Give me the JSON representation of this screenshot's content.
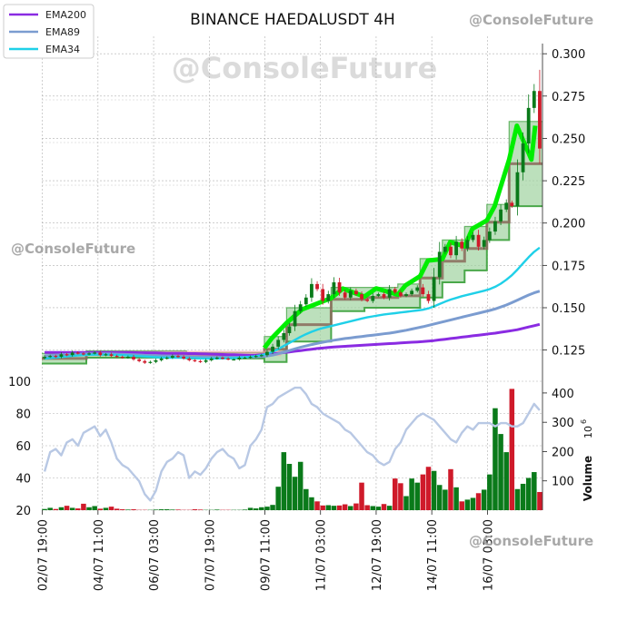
{
  "chart_data": {
    "type": "candlestick",
    "title": "BINANCE HAEDALUSDT 4H",
    "watermark": "@ConsoleFuture",
    "price_axis": {
      "range": [
        0.113,
        0.306
      ],
      "ticks": [
        0.125,
        0.15,
        0.175,
        0.2,
        0.225,
        0.25,
        0.275,
        0.3
      ],
      "tick_labels": [
        "0.125",
        "0.150",
        "0.175",
        "0.200",
        "0.225",
        "0.250",
        "0.275",
        "0.300"
      ]
    },
    "oscillator_axis": {
      "range": [
        20,
        100
      ],
      "ticks": [
        20,
        40,
        60,
        80,
        100
      ],
      "tick_labels": [
        "20",
        "40",
        "60",
        "80",
        "100"
      ]
    },
    "volume_axis": {
      "label": "Volume",
      "unit_label": "10",
      "unit_exponent": "6",
      "range": [
        0,
        440
      ],
      "ticks": [
        100,
        200,
        300,
        400
      ],
      "tick_labels": [
        "100",
        "200",
        "300",
        "400"
      ]
    },
    "x_axis": {
      "candles": 90,
      "tick_indices": [
        0,
        10,
        20,
        30,
        40,
        50,
        60,
        70,
        80
      ],
      "tick_labels": [
        "02/07 19:00",
        "04/07 11:00",
        "06/07 03:00",
        "07/07 19:00",
        "09/07 11:00",
        "11/07 03:00",
        "12/07 19:00",
        "14/07 11:00",
        "16/07 03:00"
      ]
    },
    "legend": {
      "placement": "top-left",
      "entries": [
        {
          "name": "EMA200",
          "color": "#8a2be2"
        },
        {
          "name": "EMA89",
          "color": "#7b9cd0"
        },
        {
          "name": "EMA34",
          "color": "#1fd0e8"
        }
      ]
    },
    "colors": {
      "up": "#0a7a1a",
      "down": "#cf1a2a",
      "band_fill": "#9fd39f",
      "band_edge": "#4aa84a",
      "band_core": "#00ee00",
      "band_mid": "#8a6a5a",
      "early_band": "#ff9aa6",
      "oscillator": "#b8c8e4"
    },
    "close": [
      0.121,
      0.1215,
      0.121,
      0.1225,
      0.122,
      0.1235,
      0.123,
      0.1225,
      0.123,
      0.1235,
      0.122,
      0.1225,
      0.1215,
      0.121,
      0.1205,
      0.121,
      0.1195,
      0.1185,
      0.1175,
      0.118,
      0.119,
      0.12,
      0.1205,
      0.1215,
      0.121,
      0.12,
      0.119,
      0.1185,
      0.118,
      0.119,
      0.12,
      0.1205,
      0.12,
      0.1195,
      0.1195,
      0.1205,
      0.1205,
      0.121,
      0.1215,
      0.122,
      0.124,
      0.127,
      0.131,
      0.135,
      0.139,
      0.148,
      0.152,
      0.156,
      0.164,
      0.161,
      0.154,
      0.158,
      0.165,
      0.159,
      0.156,
      0.16,
      0.158,
      0.155,
      0.154,
      0.157,
      0.158,
      0.156,
      0.161,
      0.159,
      0.157,
      0.158,
      0.16,
      0.162,
      0.158,
      0.154,
      0.168,
      0.183,
      0.186,
      0.181,
      0.189,
      0.185,
      0.19,
      0.193,
      0.186,
      0.19,
      0.195,
      0.201,
      0.208,
      0.212,
      0.21,
      0.23,
      0.247,
      0.268,
      0.278,
      0.244
    ],
    "ema200": [
      0.1236,
      0.1236,
      0.1236,
      0.1236,
      0.1236,
      0.1236,
      0.1236,
      0.1236,
      0.1236,
      0.1236,
      0.1236,
      0.1236,
      0.1236,
      0.1236,
      0.1236,
      0.1236,
      0.1235,
      0.1234,
      0.1234,
      0.1233,
      0.1233,
      0.1232,
      0.1231,
      0.1231,
      0.123,
      0.123,
      0.1229,
      0.1229,
      0.1228,
      0.1227,
      0.1226,
      0.1225,
      0.1224,
      0.1223,
      0.1222,
      0.1221,
      0.122,
      0.1219,
      0.122,
      0.1222,
      0.1225,
      0.1228,
      0.1231,
      0.1235,
      0.1239,
      0.1243,
      0.1247,
      0.1251,
      0.1255,
      0.1259,
      0.1262,
      0.1265,
      0.1268,
      0.127,
      0.1272,
      0.1274,
      0.1276,
      0.1278,
      0.128,
      0.1282,
      0.1284,
      0.1286,
      0.1288,
      0.129,
      0.1292,
      0.1294,
      0.1296,
      0.1298,
      0.13,
      0.1303,
      0.1306,
      0.131,
      0.1314,
      0.1318,
      0.1322,
      0.1326,
      0.133,
      0.1334,
      0.1338,
      0.1342,
      0.1346,
      0.135,
      0.1355,
      0.136,
      0.1365,
      0.137,
      0.1378,
      0.1386,
      0.1394,
      0.1402
    ],
    "ema89": [
      0.1216,
      0.1218,
      0.122,
      0.1222,
      0.1224,
      0.1225,
      0.1226,
      0.1227,
      0.1228,
      0.1228,
      0.1228,
      0.1228,
      0.1227,
      0.1226,
      0.1225,
      0.1224,
      0.1223,
      0.1221,
      0.1219,
      0.1218,
      0.1217,
      0.1216,
      0.1215,
      0.1214,
      0.1213,
      0.1212,
      0.1211,
      0.121,
      0.1209,
      0.1208,
      0.1208,
      0.1207,
      0.1207,
      0.1207,
      0.1207,
      0.1207,
      0.1208,
      0.1209,
      0.121,
      0.1212,
      0.1215,
      0.122,
      0.1228,
      0.1237,
      0.1247,
      0.1257,
      0.1266,
      0.1274,
      0.1282,
      0.1289,
      0.1296,
      0.1302,
      0.1308,
      0.1313,
      0.1318,
      0.1322,
      0.1326,
      0.133,
      0.1334,
      0.1338,
      0.1342,
      0.1346,
      0.135,
      0.1355,
      0.1361,
      0.1367,
      0.1374,
      0.1381,
      0.1388,
      0.1396,
      0.1404,
      0.1412,
      0.142,
      0.1428,
      0.1436,
      0.1444,
      0.1452,
      0.146,
      0.1468,
      0.1476,
      0.1484,
      0.1493,
      0.1504,
      0.1516,
      0.153,
      0.1545,
      0.156,
      0.1575,
      0.1588,
      0.1598
    ],
    "ema34": [
      0.12,
      0.1203,
      0.1206,
      0.1209,
      0.1212,
      0.1215,
      0.1218,
      0.122,
      0.1222,
      0.1223,
      0.1223,
      0.1223,
      0.1222,
      0.1221,
      0.122,
      0.1218,
      0.1216,
      0.1214,
      0.1212,
      0.121,
      0.1208,
      0.1206,
      0.1205,
      0.1205,
      0.1205,
      0.1204,
      0.1203,
      0.1202,
      0.1201,
      0.12,
      0.12,
      0.12,
      0.1201,
      0.1202,
      0.1203,
      0.1205,
      0.1207,
      0.121,
      0.1214,
      0.122,
      0.1228,
      0.124,
      0.1256,
      0.1274,
      0.1292,
      0.131,
      0.1328,
      0.1344,
      0.1358,
      0.137,
      0.138,
      0.1388,
      0.1396,
      0.1404,
      0.1412,
      0.142,
      0.1428,
      0.1436,
      0.1443,
      0.1449,
      0.1455,
      0.146,
      0.1464,
      0.1468,
      0.1472,
      0.1476,
      0.148,
      0.1484,
      0.1488,
      0.1496,
      0.1508,
      0.1522,
      0.1536,
      0.1548,
      0.1558,
      0.1568,
      0.1576,
      0.1584,
      0.1592,
      0.16,
      0.161,
      0.1624,
      0.1642,
      0.1665,
      0.1692,
      0.1725,
      0.1762,
      0.1798,
      0.183,
      0.1855
    ],
    "oscillator": [
      44,
      56,
      58,
      54,
      62,
      64,
      60,
      68,
      70,
      72,
      66,
      70,
      62,
      52,
      48,
      46,
      42,
      38,
      30,
      26,
      32,
      44,
      50,
      52,
      56,
      54,
      40,
      44,
      42,
      46,
      52,
      56,
      58,
      54,
      52,
      46,
      48,
      60,
      64,
      70,
      84,
      86,
      90,
      92,
      94,
      96,
      96,
      92,
      86,
      84,
      80,
      78,
      76,
      74,
      70,
      68,
      64,
      60,
      56,
      54,
      50,
      48,
      50,
      58,
      62,
      70,
      74,
      78,
      80,
      78,
      76,
      72,
      68,
      64,
      62,
      68,
      72,
      70,
      74,
      74,
      74,
      72,
      74,
      74,
      72,
      72,
      74,
      80,
      86,
      82
    ],
    "volume": [
      4,
      8,
      4,
      10,
      15,
      8,
      6,
      22,
      10,
      14,
      5,
      8,
      12,
      5,
      3,
      2,
      3,
      1,
      1,
      1,
      2,
      3,
      3,
      2,
      2,
      1,
      1,
      3,
      2,
      1,
      1,
      2,
      1,
      1,
      1,
      1,
      2,
      8,
      6,
      10,
      12,
      18,
      80,
      198,
      158,
      114,
      165,
      72,
      44,
      30,
      16,
      17,
      15,
      16,
      20,
      14,
      23,
      94,
      17,
      14,
      12,
      21,
      15,
      108,
      92,
      48,
      108,
      94,
      122,
      148,
      134,
      86,
      70,
      140,
      78,
      30,
      36,
      42,
      58,
      70,
      122,
      348,
      260,
      198,
      414,
      72,
      90,
      110,
      130,
      62
    ],
    "band": {
      "ranges": [
        [
          0,
          8
        ],
        [
          8,
          26
        ],
        [
          26,
          40
        ],
        [
          40,
          44
        ],
        [
          44,
          52
        ],
        [
          52,
          58
        ],
        [
          58,
          64
        ],
        [
          64,
          68
        ],
        [
          68,
          72
        ],
        [
          72,
          76
        ],
        [
          76,
          80
        ],
        [
          80,
          84
        ],
        [
          84,
          88
        ],
        [
          88,
          90
        ]
      ],
      "lower": [
        0.117,
        0.1205,
        0.12,
        0.118,
        0.13,
        0.148,
        0.15,
        0.15,
        0.156,
        0.165,
        0.172,
        0.19,
        0.21,
        0.21
      ],
      "upper": [
        0.123,
        0.1245,
        0.1235,
        0.133,
        0.15,
        0.162,
        0.162,
        0.164,
        0.179,
        0.19,
        0.198,
        0.211,
        0.26,
        0.26
      ]
    }
  }
}
